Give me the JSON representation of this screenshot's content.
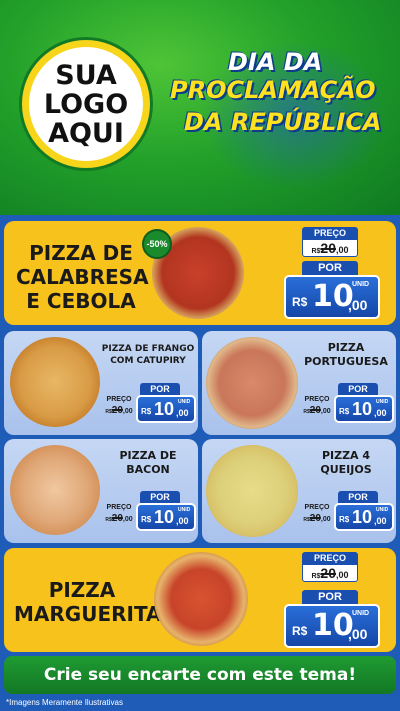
{
  "header": {
    "logo_line1": "SUA",
    "logo_line2": "LOGO",
    "logo_line3": "AQUI",
    "banner_line1": "DIA DA",
    "banner_line2": "PROCLAMAÇÃO",
    "banner_line3": "DA REPÚBLICA"
  },
  "labels": {
    "preco": "PREÇO",
    "por": "POR",
    "currency": "R$",
    "unid": "UNID",
    "old_price_int": "20",
    "old_price_dec": ",00",
    "new_price_int": "10",
    "new_price_dec": ",00",
    "rs_old": "R$"
  },
  "products": {
    "calabresa": {
      "line1": "PIZZA DE",
      "line2": "CALABRESA",
      "line3": "E CEBOLA",
      "badge": "-50%"
    },
    "frango": {
      "line1": "PIZZA DE FRANGO",
      "line2": "COM CATUPIRY"
    },
    "portuguesa": {
      "line1": "PIZZA",
      "line2": "PORTUGUESA"
    },
    "bacon": {
      "line1": "PIZZA DE",
      "line2": "BACON"
    },
    "queijos": {
      "line1": "PIZZA 4",
      "line2": "QUEIJOS"
    },
    "marguerita": {
      "line1": "PIZZA",
      "line2": "MARGUERITA"
    }
  },
  "footer": {
    "cta": "Crie seu encarte com este tema!",
    "disclaimer": "*Imagens Meramente Ilustrativas"
  },
  "colors": {
    "green": "#1f9b33",
    "yellow": "#f7c21b",
    "blue": "#1a4fb0",
    "light_blue": "#c5d7f4"
  }
}
